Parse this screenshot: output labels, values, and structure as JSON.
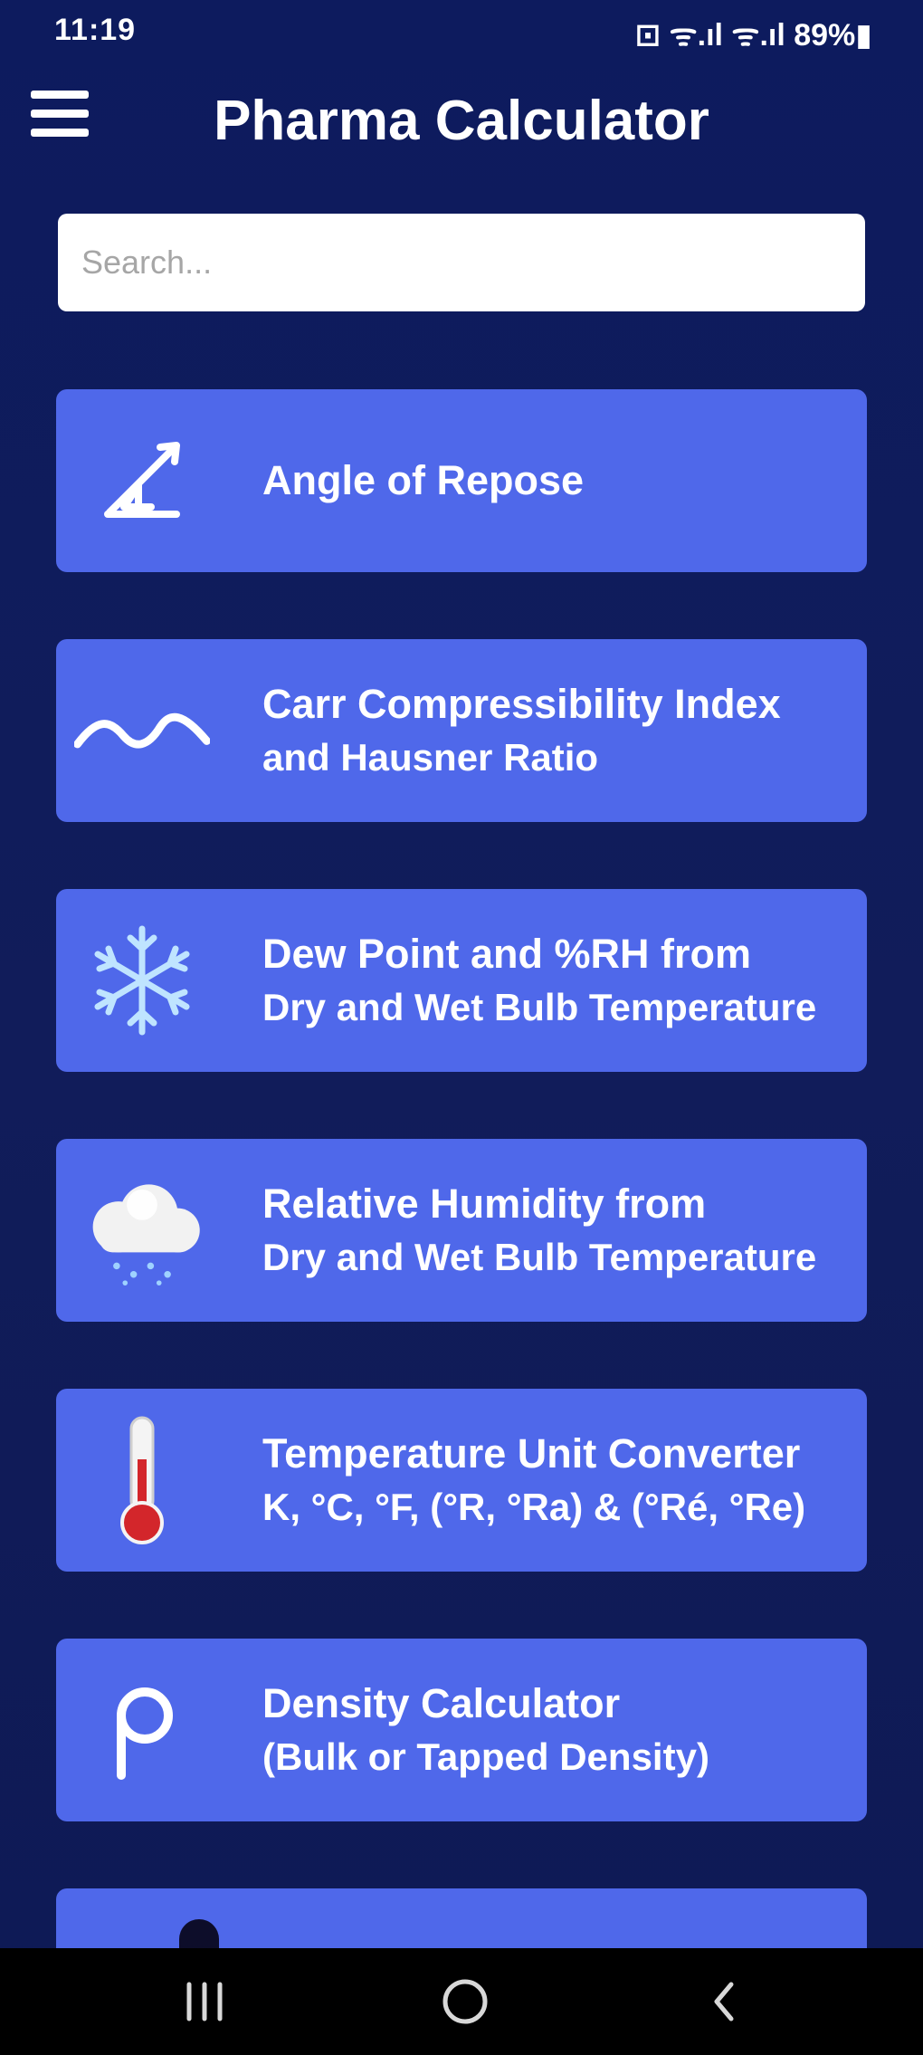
{
  "status_bar": {
    "time": "11:19",
    "right_text": "⊡ ᯤ.ıl ᯤ.ıl 89%▮"
  },
  "header": {
    "title": "Pharma Calculator",
    "menu_icon": "hamburger-menu-icon"
  },
  "search": {
    "placeholder": "Search...",
    "value": ""
  },
  "cards": [
    {
      "line1": "Angle of Repose",
      "line2": "",
      "icon": "angle-icon"
    },
    {
      "line1": "Carr Compressibility Index",
      "line2": "and Hausner Ratio",
      "icon": "wave-icon"
    },
    {
      "line1": "Dew Point and %RH from",
      "line2": "Dry and Wet Bulb Temperature",
      "icon": "snowflake-icon"
    },
    {
      "line1": "Relative Humidity from",
      "line2": "Dry and Wet Bulb Temperature",
      "icon": "cloud-rain-icon"
    },
    {
      "line1": "Temperature Unit Converter",
      "line2": "K, °C, °F, (°R, °Ra) & (°Ré, °Re)",
      "icon": "thermometer-icon"
    },
    {
      "line1": "Density Calculator",
      "line2": "(Bulk or Tapped Density)",
      "icon": "rho-icon"
    }
  ],
  "nav_bar": {
    "recents_icon": "recents-icon",
    "home_icon": "home-icon",
    "back_icon": "back-icon"
  },
  "colors": {
    "background": "#0f1a5c",
    "card": "#4f68ea",
    "text": "#ffffff"
  }
}
